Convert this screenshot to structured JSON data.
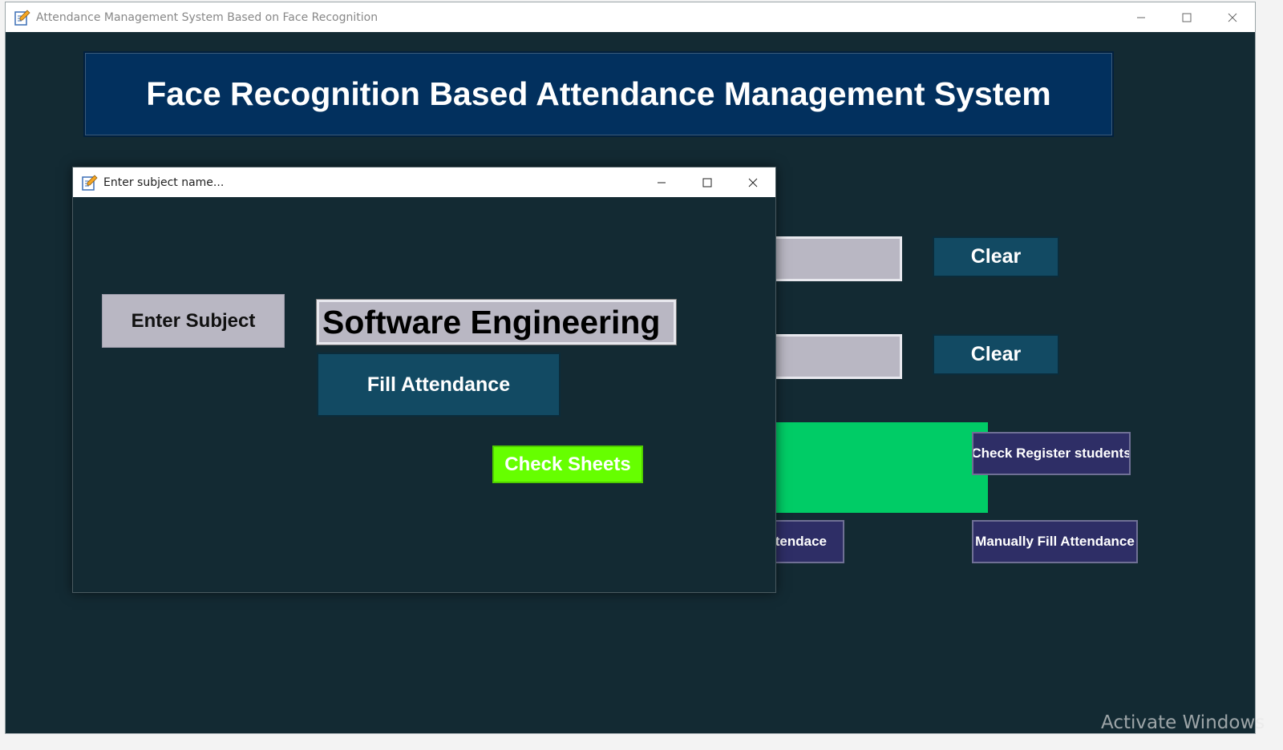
{
  "main_window": {
    "title": "Attendance Management System Based on Face Recognition",
    "header": "Face Recognition Based Attendance Management System",
    "clear_button_1": "Clear",
    "clear_button_2": "Clear",
    "attendance_button_partial": "tendace",
    "check_register_students": "Check Register students",
    "manually_fill_attendance": "Manually Fill Attendance"
  },
  "dialog": {
    "title": "Enter subject name...",
    "enter_subject_label": "Enter Subject",
    "subject_value": "Software Engineering",
    "fill_attendance": "Fill Attendance",
    "check_sheets": "Check Sheets"
  },
  "watermark": "Activate Windows",
  "icons": {
    "app": "notepad-pencil-icon",
    "minimize": "minimize-icon",
    "maximize": "maximize-icon",
    "close": "close-icon"
  },
  "colors": {
    "background": "#132a33",
    "banner": "#02305e",
    "teal_button": "#124a63",
    "navy_button": "#2e2e66",
    "green_panel": "#00cc66",
    "check_sheets": "#66ff00",
    "grey_field": "#b9b7c3"
  }
}
